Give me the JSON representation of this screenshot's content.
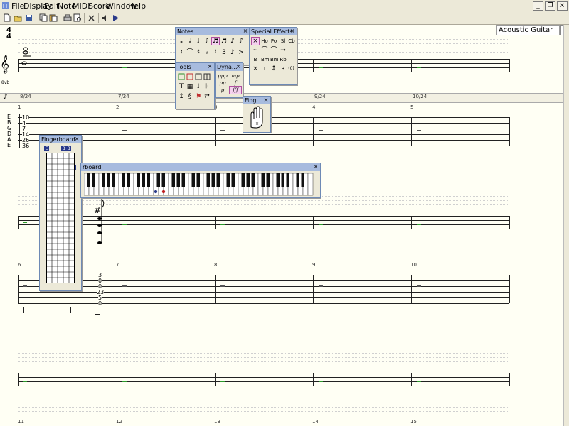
{
  "menu": [
    "File",
    "Display",
    "Edit",
    "Note",
    "MIDI",
    "Score",
    "Window",
    "Help"
  ],
  "toolbar": {
    "instrument": "Acoustic Guitar",
    "instrument_num": "1"
  },
  "score": {
    "time_sig_top": "4",
    "time_sig_bottom": "4",
    "clef_mark": "8vb",
    "tuning": [
      "E",
      "B",
      "G",
      "D",
      "A",
      "E"
    ],
    "first_frets": [
      "10",
      "4",
      "7",
      "14",
      "26",
      "36"
    ],
    "beat_labels": [
      "8/24",
      "7/24",
      "9/24",
      "10/24"
    ],
    "measure_numbers_row1": [
      "1",
      "2",
      "3",
      "4",
      "5"
    ],
    "measure_numbers_row2": [
      "6",
      "7",
      "8",
      "9",
      "10"
    ],
    "measure_numbers_row3": [
      "11",
      "12",
      "13",
      "14",
      "15"
    ],
    "chord_frets": [
      "3",
      "0",
      "0",
      "23",
      "5",
      "0"
    ]
  },
  "palettes": {
    "notes": {
      "title": "Notes"
    },
    "special_effects": {
      "title": "Special Effects",
      "row1": [
        "Ho",
        "Po",
        "Sl",
        "Cb"
      ],
      "row2": [
        "~",
        "⌒",
        "⌒",
        "→"
      ],
      "row3": [
        "B",
        "Bm",
        "Bm",
        "Rb"
      ],
      "row4": [
        "×",
        "T",
        "↕",
        "R",
        "(0)"
      ]
    },
    "tools": {
      "title": "Tools"
    },
    "dynamics": {
      "title": "Dyna...",
      "items": [
        "ppp",
        "pp",
        "p",
        "mp",
        "f",
        "fff"
      ]
    },
    "fingering": {
      "title": "Fing..."
    },
    "fingerboard": {
      "title": "Fingerboard",
      "strings": [
        "E",
        "B",
        "B",
        "G",
        "D",
        "D"
      ]
    },
    "keyboard": {
      "title": "Keyboard",
      "visible_title": "rboard"
    }
  },
  "colors": {
    "accent": "#2a9a2a",
    "titlebar": "#a7bbde",
    "selected": "#f5d0ee"
  }
}
